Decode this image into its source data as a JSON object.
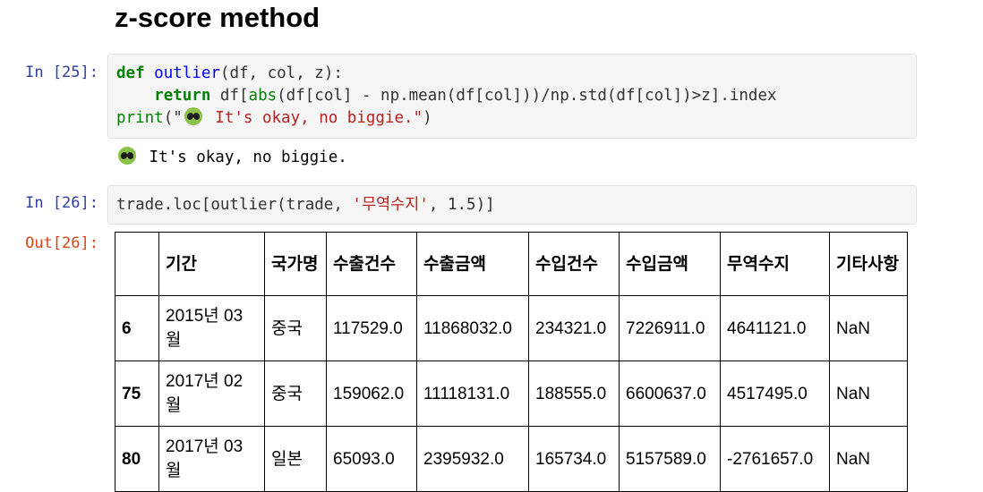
{
  "heading": "z-score method",
  "cells": [
    {
      "prompt": "In [25]:",
      "code": {
        "l1_def": "def",
        "l1_fn": "outlier",
        "l1_args": "(df, col, z):",
        "l2_indent": "    ",
        "l2_return": "return",
        "l2_a": " df[",
        "l2_abs": "abs",
        "l2_b": "(df[col] - np.mean(df[col]))/np.std(df[col])>z].index",
        "l3_print": "print",
        "l3_open": "(\"",
        "l3_str": " It's okay, no biggie.\"",
        "l3_close": ")"
      },
      "output_icon": "alien-emoji-icon",
      "output_text": " It's okay, no biggie."
    },
    {
      "prompt": "In [26]:",
      "code": {
        "a": "trade.loc[outlier(trade, ",
        "str": "'무역수지'",
        "b": ", 1.5)]"
      },
      "out_prompt": "Out[26]:"
    }
  ],
  "table": {
    "columns": [
      "",
      "기간",
      "국가명",
      "수출건수",
      "수출금액",
      "수입건수",
      "수입금액",
      "무역수지",
      "기타사항"
    ],
    "rows": [
      {
        "index": "6",
        "cells": [
          "2015년 03월",
          "중국",
          "117529.0",
          "11868032.0",
          "234321.0",
          "7226911.0",
          "4641121.0",
          "NaN"
        ]
      },
      {
        "index": "75",
        "cells": [
          "2017년 02월",
          "중국",
          "159062.0",
          "11118131.0",
          "188555.0",
          "6600637.0",
          "4517495.0",
          "NaN"
        ]
      },
      {
        "index": "80",
        "cells": [
          "2017년 03월",
          "일본",
          "65093.0",
          "2395932.0",
          "165734.0",
          "5157589.0",
          "-2761657.0",
          "NaN"
        ]
      }
    ]
  }
}
